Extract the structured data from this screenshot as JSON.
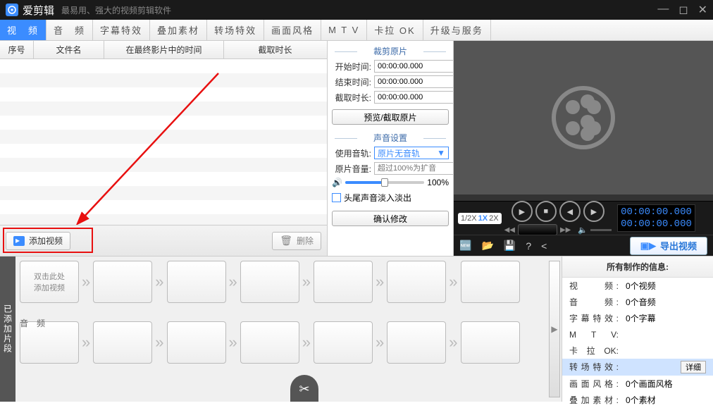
{
  "title_bar": {
    "app_name": "爱剪辑",
    "subtitle": "最易用、强大的视频剪辑软件"
  },
  "tabs": [
    "视　频",
    "音　频",
    "字幕特效",
    "叠加素材",
    "转场特效",
    "画面风格",
    "M T V",
    "卡拉 OK",
    "升级与服务"
  ],
  "table": {
    "cols": [
      "序号",
      "文件名",
      "在最终影片中的时间",
      "截取时长"
    ]
  },
  "buttons": {
    "add_video": "添加视频",
    "delete": "删除",
    "preview_cut": "预览/截取原片",
    "confirm": "确认修改",
    "export": "导出视频"
  },
  "trim": {
    "title": "裁剪原片",
    "start_label": "开始时间:",
    "end_label": "结束时间:",
    "cut_label": "截取时长:",
    "start_value": "00:00:00.000",
    "end_value": "00:00:00.000",
    "cut_value": "00:00:00.000"
  },
  "sound": {
    "title": "声音设置",
    "track_label": "使用音轨:",
    "track_value": "原片无音轨",
    "volume_label": "原片音量:",
    "volume_placeholder": "超过100%为扩音",
    "volume_value": "100%",
    "fade_label": "头尾声音淡入淡出"
  },
  "speed": [
    "1/2X",
    "1X",
    "2X"
  ],
  "timecode": {
    "a": "00:00:00.000",
    "b": "00:00:00.000"
  },
  "timeline": {
    "tab_label": "已添加片段",
    "clip_hint_1": "双击此处",
    "clip_hint_2": "添加视频",
    "audio_label": "音　频"
  },
  "info": {
    "title": "所有制作的信息:",
    "rows": [
      {
        "lab": "视　　频:",
        "val": "0个视频"
      },
      {
        "lab": "音　　频:",
        "val": "0个音频"
      },
      {
        "lab": "字幕特效:",
        "val": "0个字幕"
      },
      {
        "lab": "M　T　V:",
        "val": ""
      },
      {
        "lab": "卡 拉 OK:",
        "val": ""
      },
      {
        "lab": "转场特效:",
        "val": "",
        "detail": "详细",
        "hl": true
      },
      {
        "lab": "画面风格:",
        "val": "0个画面风格"
      },
      {
        "lab": "叠加素材:",
        "val": "0个素材"
      }
    ]
  }
}
